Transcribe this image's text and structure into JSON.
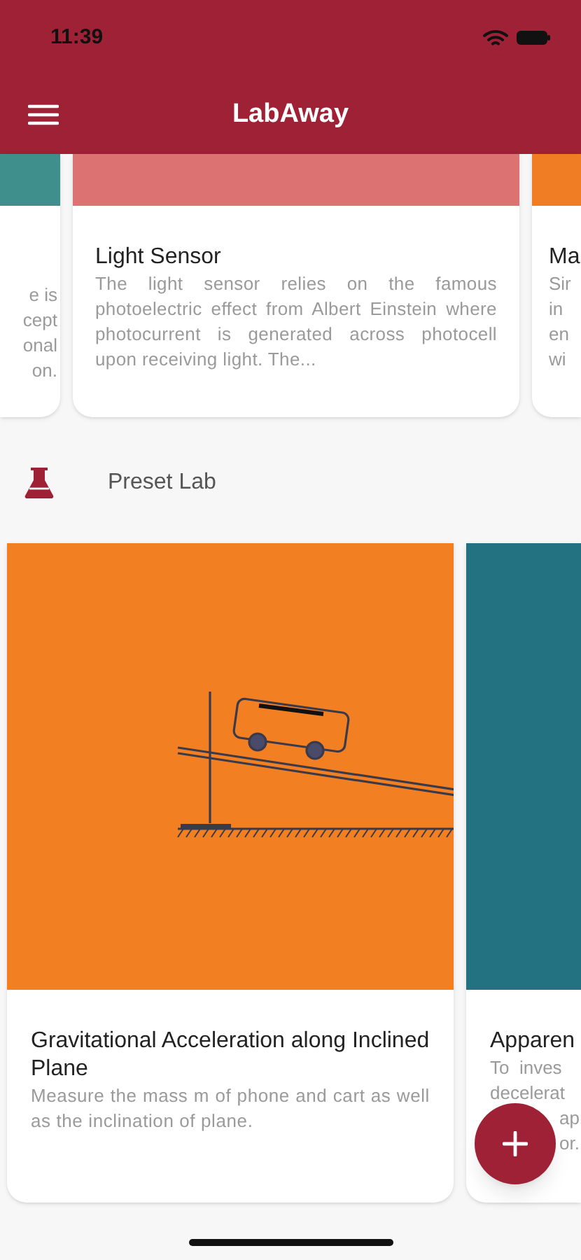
{
  "status_bar": {
    "time": "11:39"
  },
  "header": {
    "title": "LabAway"
  },
  "sensor_cards": [
    {
      "kind": "partial_left",
      "color": "#3f8f8c",
      "lines": [
        "e is",
        "cept",
        "onal",
        "on."
      ]
    },
    {
      "kind": "full",
      "color": "#dc7272",
      "title": "Light Sensor",
      "description": "The light sensor relies on the famous photoelectric effect from Albert Einstein where photocurrent is generated across photocell upon receiving light. The..."
    },
    {
      "kind": "partial_right",
      "color": "#f07c24",
      "title": "Ma",
      "lines": [
        "Sir",
        "in",
        "en",
        "wi"
      ]
    }
  ],
  "section": {
    "title": "Preset Lab"
  },
  "lab_cards": [
    {
      "kind": "full",
      "color": "#f28023",
      "title": "Gravitational Acceleration along Inclined Plane",
      "description": "Measure the mass m of phone and cart as well as the inclination of plane."
    },
    {
      "kind": "partial_right",
      "color": "#237282",
      "title": "Apparen",
      "lines": [
        "To  inves",
        "decelerat",
        "ap",
        "or."
      ]
    }
  ]
}
